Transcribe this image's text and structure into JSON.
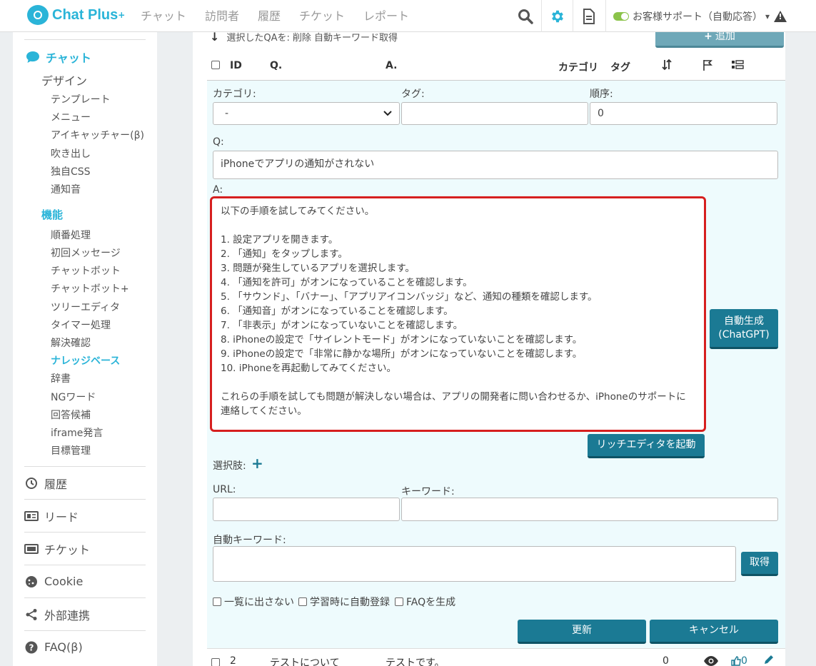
{
  "brand": {
    "name": "Chat Plus",
    "plus": "+"
  },
  "nav": [
    "チャット",
    "訪問者",
    "履歴",
    "チケット",
    "レポート"
  ],
  "status": {
    "label": "お客様サポート（自動応答）",
    "caret": "▾",
    "warn": "!"
  },
  "sidebar": {
    "chat": "チャット",
    "design": "デザイン",
    "design_items": [
      "テンプレート",
      "メニュー",
      "アイキャッチャー(β)",
      "吹き出し",
      "独自CSS",
      "通知音"
    ],
    "function": "機能",
    "function_items": [
      "順番処理",
      "初回メッセージ",
      "チャットボット",
      "チャットボット+",
      "ツリーエディタ",
      "タイマー処理",
      "解決確認",
      "ナレッジベース",
      "辞書",
      "NGワード",
      "回答候補",
      "iframe発言",
      "目標管理"
    ],
    "sections": [
      "履歴",
      "リード",
      "チケット",
      "Cookie",
      "外部連携",
      "FAQ(β)"
    ]
  },
  "toolbar": {
    "selected_text": "選択したQAを:",
    "delete": "削除",
    "auto_kw": "自動キーワード取得",
    "add_button": "追加"
  },
  "table": {
    "headers": {
      "id": "ID",
      "q": "Q.",
      "a": "A.",
      "category": "カテゴリ",
      "tag": "タグ"
    }
  },
  "form": {
    "category_label": "カテゴリ:",
    "category_value": "-",
    "tag_label": "タグ:",
    "tag_value": "",
    "order_label": "順序:",
    "order_value": "0",
    "q_label": "Q:",
    "q_value": "iPhoneでアプリの通知がされない",
    "a_label": "A:",
    "a_value": "以下の手順を試してみてください。\n\n1. 設定アプリを開きます。\n2. 「通知」をタップします。\n3. 問題が発生しているアプリを選択します。\n4. 「通知を許可」がオンになっていることを確認します。\n5. 「サウンド」、「バナー」、「アプリアイコンバッジ」など、通知の種類を確認します。\n6. 「通知音」がオンになっていることを確認します。\n7. 「非表示」がオンになっていないことを確認します。\n8. iPhoneの設定で「サイレントモード」がオンになっていないことを確認します。\n9. iPhoneの設定で「非常に静かな場所」がオンになっていないことを確認します。\n10. iPhoneを再起動してみてください。\n\nこれらの手順を試しても問題が解決しない場合は、アプリの開発者に問い合わせるか、iPhoneのサポートに連絡してください。",
    "autogen_button": "自動生成\n(ChatGPT)",
    "rich_editor_button": "リッチエディタを起動",
    "choices_label": "選択肢:",
    "add_choice": "+",
    "url_label": "URL:",
    "url_value": "",
    "keyword_label": "キーワード:",
    "keyword_value": "",
    "auto_keyword_label": "自動キーワード:",
    "auto_keyword_value": "",
    "fetch_button": "取得",
    "opt_hide": "一覧に出さない",
    "opt_learn": "学習時に自動登録",
    "opt_faq": "FAQを生成",
    "update_button": "更新",
    "cancel_button": "キャンセル"
  },
  "row2": {
    "id": "2",
    "q": "テストについて",
    "a": "テストです。",
    "order": "0",
    "likes": "0"
  },
  "colors": {
    "accent": "#2ab4d8",
    "button": "#1b7a94",
    "highlight": "#d61f1f"
  }
}
